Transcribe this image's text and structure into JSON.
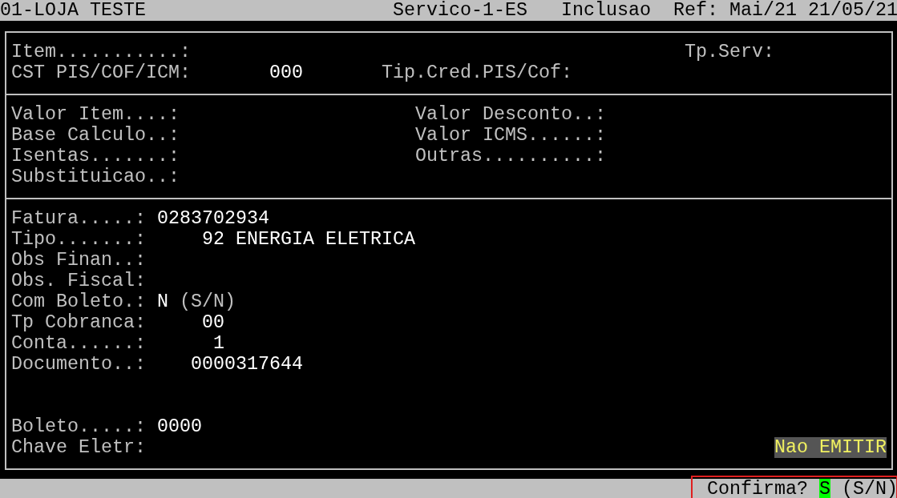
{
  "header": {
    "company": "01-LOJA TESTE",
    "service": "Servico-1-ES",
    "mode": "Inclusao",
    "reference": "Ref: Mai/21 21/05/21"
  },
  "item_section": {
    "fields": [
      {
        "label": "Item...........:"
      },
      {
        "label": "Tp.Serv:"
      },
      {
        "label": "CST PIS/COF/ICM:",
        "value": "000"
      },
      {
        "label": "Tip.Cred.PIS/Cof:"
      }
    ]
  },
  "values_section": {
    "fields": [
      {
        "label": "Valor Item....:"
      },
      {
        "label": "Valor Desconto..:"
      },
      {
        "label": "Base Calculo..:"
      },
      {
        "label": "Valor ICMS......:"
      },
      {
        "label": "Isentas.......:"
      },
      {
        "label": "Outras..........:"
      },
      {
        "label": "Substituicao..:"
      }
    ]
  },
  "billing_section": {
    "fields": [
      {
        "label": "Fatura.....:",
        "value": "0283702934"
      },
      {
        "label": "Tipo.......:",
        "value": "92 ENERGIA ELETRICA"
      },
      {
        "label": "Obs Finan..:"
      },
      {
        "label": "Obs. Fiscal:"
      },
      {
        "label": "Com Boleto.:",
        "value": "N",
        "hint": "(S/N)"
      },
      {
        "label": "Tp Cobranca:",
        "value": "00"
      },
      {
        "label": "Conta......:",
        "value": "1"
      },
      {
        "label": "Documento..:",
        "value": "0000317644"
      },
      {
        "label": "Boleto.....:",
        "value": "0000"
      },
      {
        "label": "Chave Eletr:"
      }
    ],
    "status_badge": "Nao EMITIR"
  },
  "prompt": {
    "question": "Confirma?",
    "answer": "S",
    "options": "(S/N)",
    "highlighted": true
  }
}
